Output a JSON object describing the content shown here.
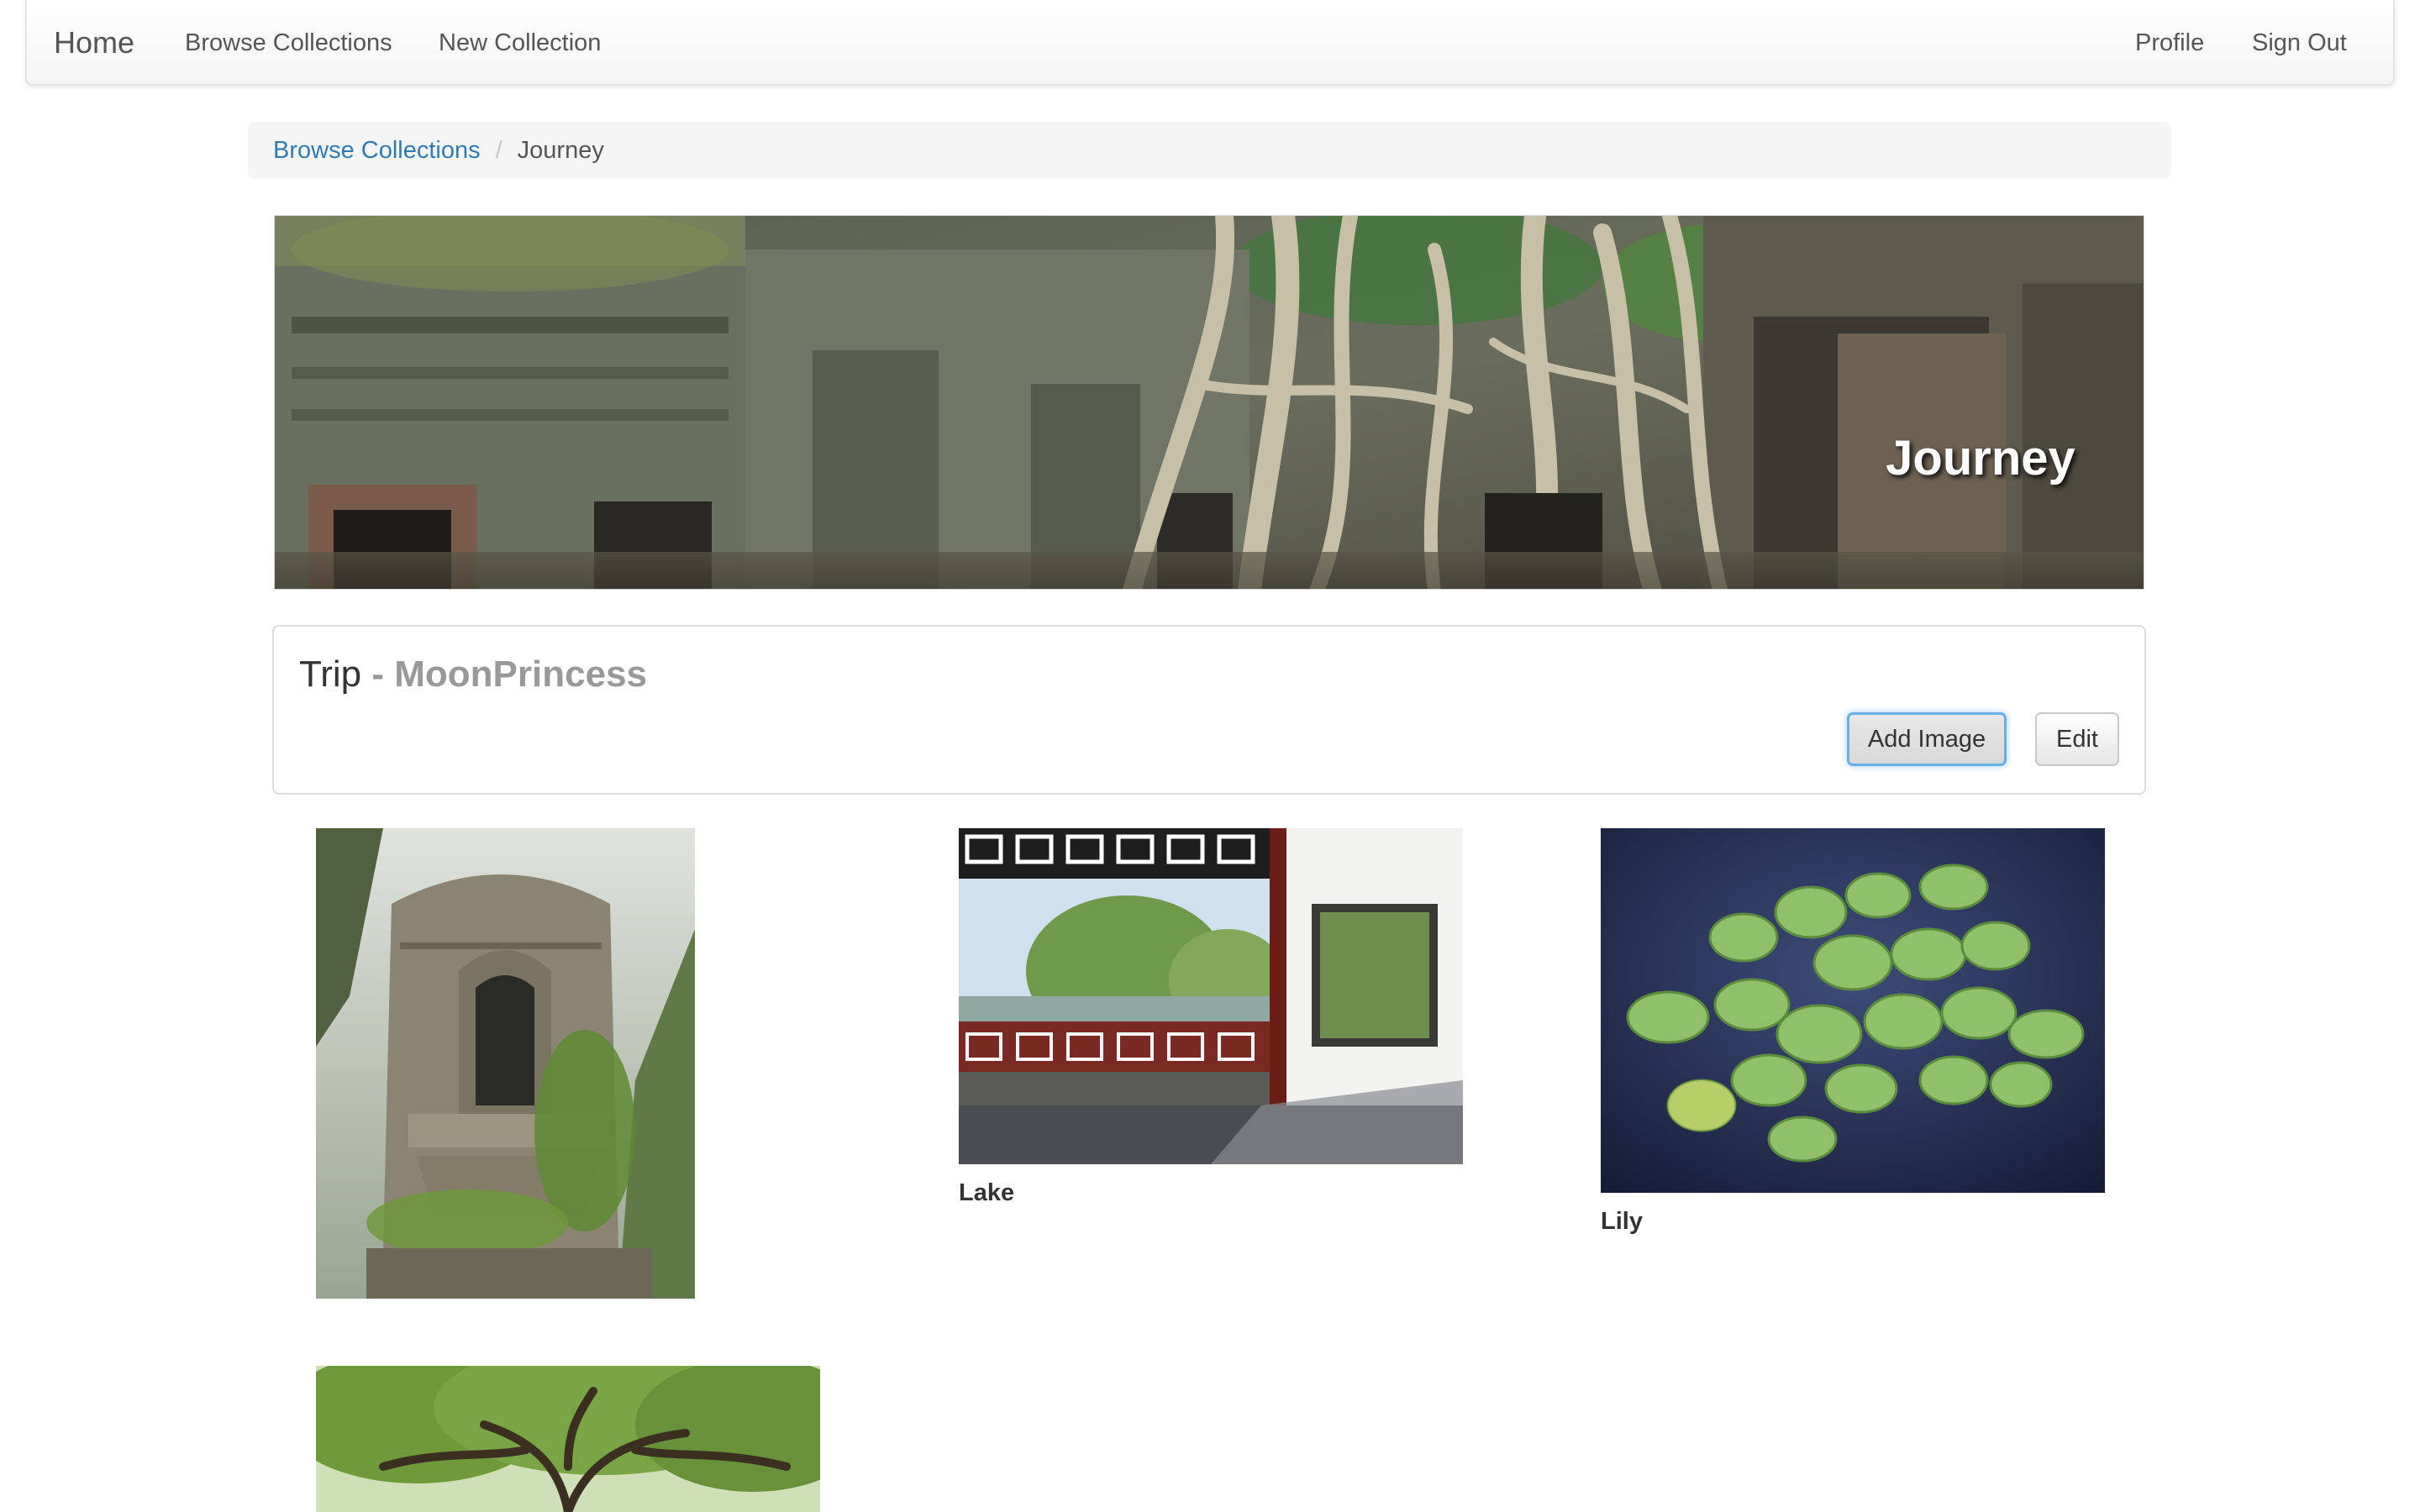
{
  "navbar": {
    "brand": "Home",
    "left_links": [
      "Browse Collections",
      "New Collection"
    ],
    "right_links": [
      "Profile",
      "Sign Out"
    ]
  },
  "breadcrumb": {
    "parent": "Browse Collections",
    "separator": "/",
    "current": "Journey"
  },
  "banner": {
    "title": "Journey",
    "image": "overgrown-temple-ruins-image"
  },
  "collection": {
    "name": "Trip",
    "owner_separator": " - ",
    "owner": "MoonPrincess",
    "add_image_label": "Add Image",
    "edit_label": "Edit"
  },
  "gallery": {
    "items": [
      {
        "image": "mossy-stone-tower-image",
        "caption": ""
      },
      {
        "image": "pavilion-lake-view-image",
        "caption": "Lake"
      },
      {
        "image": "lily-pads-water-image",
        "caption": "Lily"
      },
      {
        "image": "oak-tree-canopy-image",
        "caption": ""
      }
    ]
  }
}
